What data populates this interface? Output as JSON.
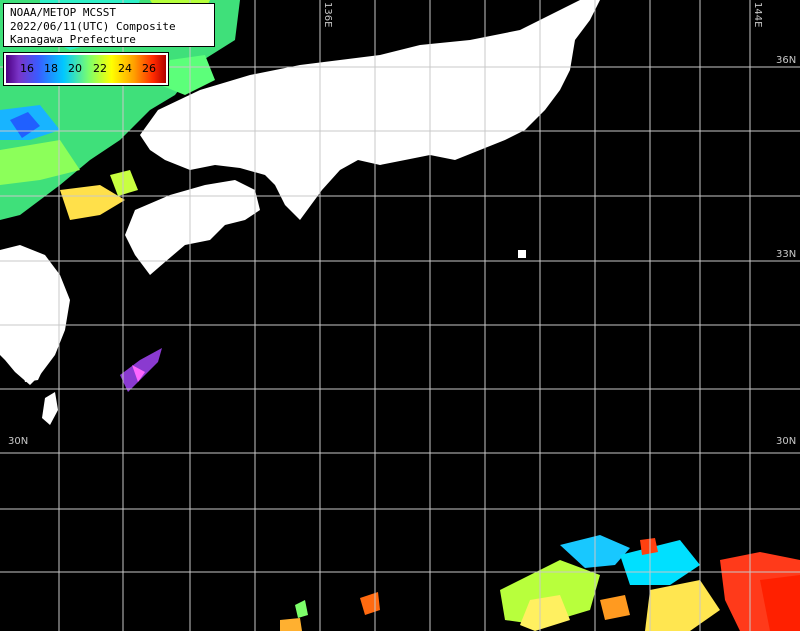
{
  "title": {
    "line1": "NOAA/METOP MCSST",
    "line2": "2022/06/11(UTC) Composite",
    "line3": "Kanagawa Prefecture"
  },
  "legend": {
    "ticks": [
      "16",
      "18",
      "20",
      "22",
      "24",
      "26"
    ],
    "colors": [
      "#4b0082",
      "#3a5bff",
      "#00c8ff",
      "#7dff6a",
      "#ffff00",
      "#ffa000",
      "#ff2a00",
      "#b00000"
    ]
  },
  "graticule": {
    "lat_labels": [
      "36N",
      "33N",
      "30N",
      "30N"
    ],
    "lon_labels": [
      "136E",
      "144E"
    ]
  },
  "colors": {
    "land": "#ffffff",
    "ocean": "#000000",
    "grid": "#c8c8c8"
  }
}
